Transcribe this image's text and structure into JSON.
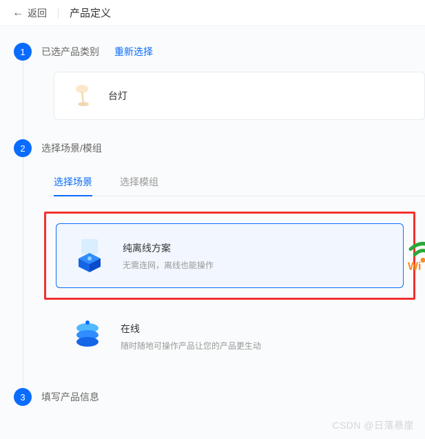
{
  "header": {
    "back_label": "返回",
    "title": "产品定义"
  },
  "step1": {
    "num": "1",
    "title": "已选产品类别",
    "reselect": "重新选择",
    "product_name": "台灯"
  },
  "step2": {
    "num": "2",
    "title": "选择场景/模组",
    "tab_scene": "选择场景",
    "tab_module": "选择模组",
    "scene_offline_title": "纯离线方案",
    "scene_offline_desc": "无需连网，离线也能操作",
    "scene_online_title": "在线",
    "scene_online_desc": "随时随地可操作产品让您的产品更生动",
    "wifi_label": "Wi"
  },
  "step3": {
    "num": "3",
    "title": "填写产品信息"
  },
  "watermark": "CSDN @日落悬崖"
}
